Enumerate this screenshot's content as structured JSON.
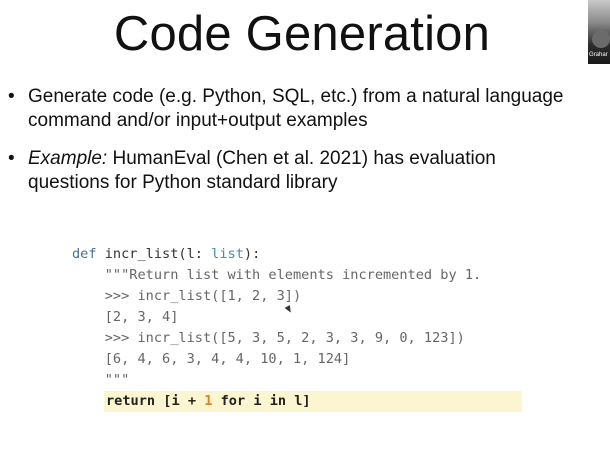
{
  "slide": {
    "title": "Code Generation",
    "bullets": [
      {
        "marker": "•",
        "prefix": "",
        "text": "Generate code (e.g. Python, SQL, etc.) from a natural language command and/or input+output examples"
      },
      {
        "marker": "•",
        "prefix": "Example:",
        "text": " HumanEval (Chen et al. 2021) has evaluation questions for Python standard library"
      }
    ]
  },
  "code": {
    "def_kw": "def",
    "func_sig_a": " incr_list(l: ",
    "type": "list",
    "func_sig_b": "):",
    "doc_lines": [
      "    \"\"\"Return list with elements incremented by 1.",
      "    >>> incr_list([1, 2, 3])",
      "    [2, 3, 4]",
      "    >>> incr_list([5, 3, 5, 2, 3, 3, 9, 0, 123])",
      "    [6, 4, 6, 3, 4, 4, 10, 1, 124]",
      "    \"\"\""
    ],
    "return_a": "return [i + ",
    "return_num": "1",
    "return_b": " for i in l]"
  },
  "webcam": {
    "label": "Grahar"
  },
  "colors": {
    "keyword": "#4a6e9c",
    "highlight": "#fbf6cf",
    "number": "#d9822b"
  }
}
